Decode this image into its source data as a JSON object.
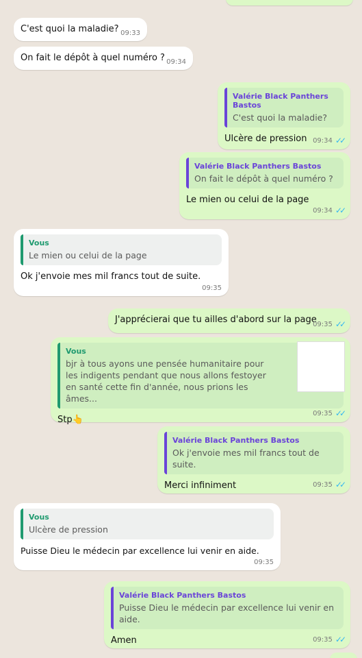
{
  "messages": [
    {
      "text": "C'est quoi la maladie?",
      "time": "09:33"
    },
    {
      "text": "On fait le dépôt à quel numéro ?",
      "time": "09:34"
    },
    {
      "quote_author": "Valérie Black Panthers Bastos",
      "quote_text": "C'est quoi la maladie?",
      "text": "Ulcère de pression",
      "time": "09:34"
    },
    {
      "quote_author": "Valérie Black Panthers Bastos",
      "quote_text": "On fait le dépôt à quel numéro ?",
      "text": "Le mien ou celui de la page",
      "time": "09:34"
    },
    {
      "quote_author": "Vous",
      "quote_text": "Le mien ou celui de la page",
      "text": "Ok j'envoie mes mil francs tout de suite.",
      "time": "09:35"
    },
    {
      "text": "J'apprécierai que tu ailles d'abord sur la page",
      "time": "09:35"
    },
    {
      "quote_author": "Vous",
      "quote_text_1": "bjr à tous ayons une pensée humanitaire pour",
      "quote_text_2": "les indigents pendant que nous allons festoyer",
      "quote_text_3": "en santé cette fin d'année, nous prions les âmes...",
      "text": "Stp👆",
      "time": "09:35"
    },
    {
      "quote_author": "Valérie Black Panthers Bastos",
      "quote_text": "Ok j'envoie mes mil francs tout de suite.",
      "text": "Merci infiniment",
      "time": "09:35"
    },
    {
      "quote_author": "Vous",
      "quote_text": "Ulcère de pression",
      "text": "Puisse Dieu le médecin par excellence lui venir en aide.",
      "time": "09:35"
    },
    {
      "quote_author": "Valérie Black Panthers Bastos",
      "quote_text": "Puisse Dieu le médecin par excellence lui venir en aide.",
      "text": "Amen",
      "time": "09:35"
    }
  ],
  "icons": {
    "read_receipt": "double-check-icon"
  },
  "colors": {
    "outgoing": "#dcf8c6",
    "incoming": "#ffffff",
    "background": "#ece5dd",
    "read_tick": "#34b7f1"
  }
}
